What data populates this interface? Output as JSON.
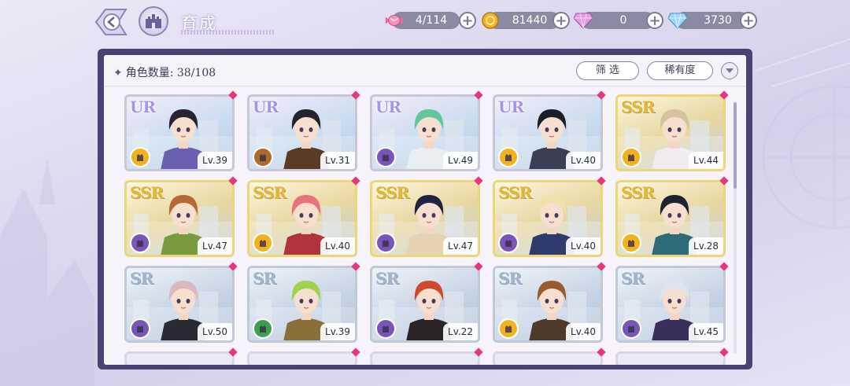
{
  "header": {
    "title": "育成"
  },
  "resources": [
    {
      "name": "candy",
      "icon": "candy-icon",
      "value": "4/114"
    },
    {
      "name": "coin",
      "icon": "coin-icon",
      "value": "81440"
    },
    {
      "name": "pink-gem",
      "icon": "pink-diamond-icon",
      "value": "0"
    },
    {
      "name": "blue-gem",
      "icon": "blue-diamond-icon",
      "value": "3730"
    }
  ],
  "panel": {
    "count_label": "角色数量: 38/108",
    "filter_label": "筛 选",
    "sort_label": "稀有度"
  },
  "colors": {
    "frame": "#4b4173",
    "ssr_gold": "#e3b634",
    "ur_purple": "#a695e6",
    "sr_silver": "#9fb3cc",
    "gem_pink": "#e8367b",
    "badge_yellow": "#f0b21e",
    "badge_brown": "#b06a2a",
    "badge_purple": "#7a55b8",
    "badge_green": "#3f9f4e"
  },
  "cards": [
    {
      "rarity": "UR",
      "level": "Lv.39",
      "badge": "yellow",
      "hair": "#2a2230",
      "outfit": "#6a5fb0"
    },
    {
      "rarity": "UR",
      "level": "Lv.31",
      "badge": "brown",
      "hair": "#22232b",
      "outfit": "#5a3b24"
    },
    {
      "rarity": "UR",
      "level": "Lv.49",
      "badge": "purple",
      "hair": "#5fc79b",
      "outfit": "#e9eef2"
    },
    {
      "rarity": "UR",
      "level": "Lv.40",
      "badge": "yellow",
      "hair": "#1b1d28",
      "outfit": "#3a3f54"
    },
    {
      "rarity": "SSR",
      "level": "Lv.44",
      "badge": "yellow",
      "hair": "#d6c2a0",
      "outfit": "#f1ecf4"
    },
    {
      "rarity": "SSR",
      "level": "Lv.47",
      "badge": "purple",
      "hair": "#b46a34",
      "outfit": "#7a9a40"
    },
    {
      "rarity": "SSR",
      "level": "Lv.40",
      "badge": "yellow",
      "hair": "#e8747b",
      "outfit": "#b0343a"
    },
    {
      "rarity": "SSR",
      "level": "Lv.47",
      "badge": "purple",
      "hair": "#1e2340",
      "outfit": "#e5d2b3"
    },
    {
      "rarity": "SSR",
      "level": "Lv.40",
      "badge": "purple",
      "hair": "#efe2a8",
      "outfit": "#2e3b6c"
    },
    {
      "rarity": "SSR",
      "level": "Lv.28",
      "badge": "yellow",
      "hair": "#1d2330",
      "outfit": "#2f6a78"
    },
    {
      "rarity": "SR",
      "level": "Lv.50",
      "badge": "purple",
      "hair": "#d9b8c0",
      "outfit": "#2a2a32"
    },
    {
      "rarity": "SR",
      "level": "Lv.39",
      "badge": "green",
      "hair": "#9fd34a",
      "outfit": "#8a6f3a"
    },
    {
      "rarity": "SR",
      "level": "Lv.22",
      "badge": "purple",
      "hair": "#d2482a",
      "outfit": "#2a2426"
    },
    {
      "rarity": "SR",
      "level": "Lv.40",
      "badge": "yellow",
      "hair": "#9a5a2e",
      "outfit": "#4d3a2a"
    },
    {
      "rarity": "SR",
      "level": "Lv.45",
      "badge": "purple",
      "hair": "#dfe3ec",
      "outfit": "#3a2f5a"
    }
  ]
}
